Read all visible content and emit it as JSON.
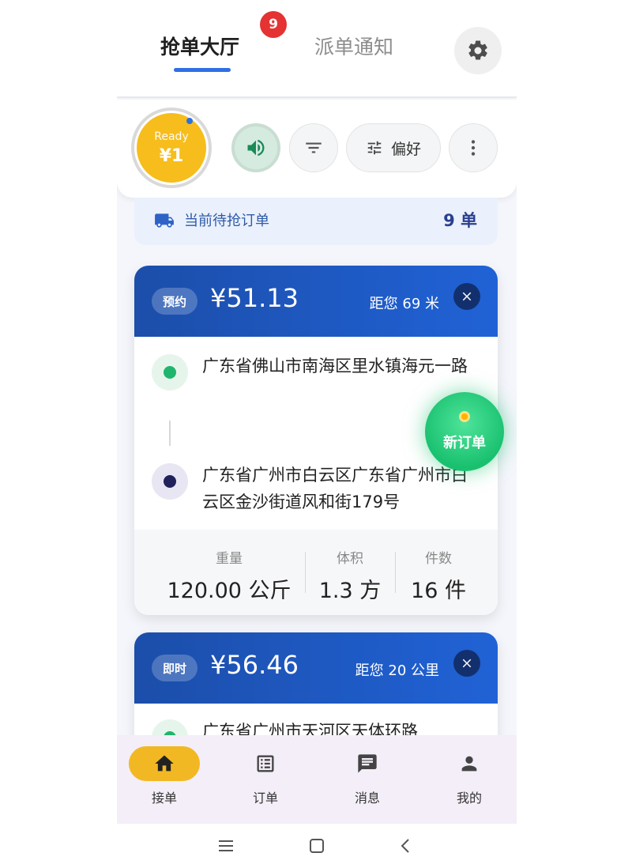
{
  "header": {
    "tabs": [
      {
        "label": "抢单大厅",
        "active": true
      },
      {
        "label": "派单通知",
        "active": false
      }
    ],
    "badge_count": "9",
    "settings_icon": "gear-icon"
  },
  "toolbar": {
    "status_text": "Ready",
    "status_price": "¥1",
    "sound_icon": "speaker-icon",
    "filter_icon": "filter-icon",
    "preference_label": "偏好",
    "more_icon": "more-vertical-icon"
  },
  "pending": {
    "label": "当前待抢订单",
    "count": "9 单"
  },
  "orders": [
    {
      "type": "预约",
      "price": "¥51.13",
      "distance": "距您 69 米",
      "pickup": "广东省佛山市南海区里水镇海元一路",
      "dropoff": "广东省广州市白云区广东省广州市白云区金沙街道风和街179号",
      "stats": [
        {
          "label": "重量",
          "value": "120.00 公斤"
        },
        {
          "label": "体积",
          "value": "1.3 方"
        },
        {
          "label": "件数",
          "value": "16 件"
        }
      ]
    },
    {
      "type": "即时",
      "price": "¥56.46",
      "distance": "距您 20 公里",
      "pickup": "广东省广州市天河区天体环路"
    }
  ],
  "floating": {
    "label": "新订单"
  },
  "nav": [
    {
      "label": "接单",
      "icon": "home-icon",
      "active": true
    },
    {
      "label": "订单",
      "icon": "list-icon",
      "active": false
    },
    {
      "label": "消息",
      "icon": "chat-icon",
      "active": false
    },
    {
      "label": "我的",
      "icon": "person-icon",
      "active": false
    }
  ],
  "colors": {
    "accent": "#2f6fe4",
    "card_header": "#1c4eaa",
    "ready": "#f7bd1c",
    "new_order": "#19c16f",
    "nav_active": "#f2b824"
  }
}
